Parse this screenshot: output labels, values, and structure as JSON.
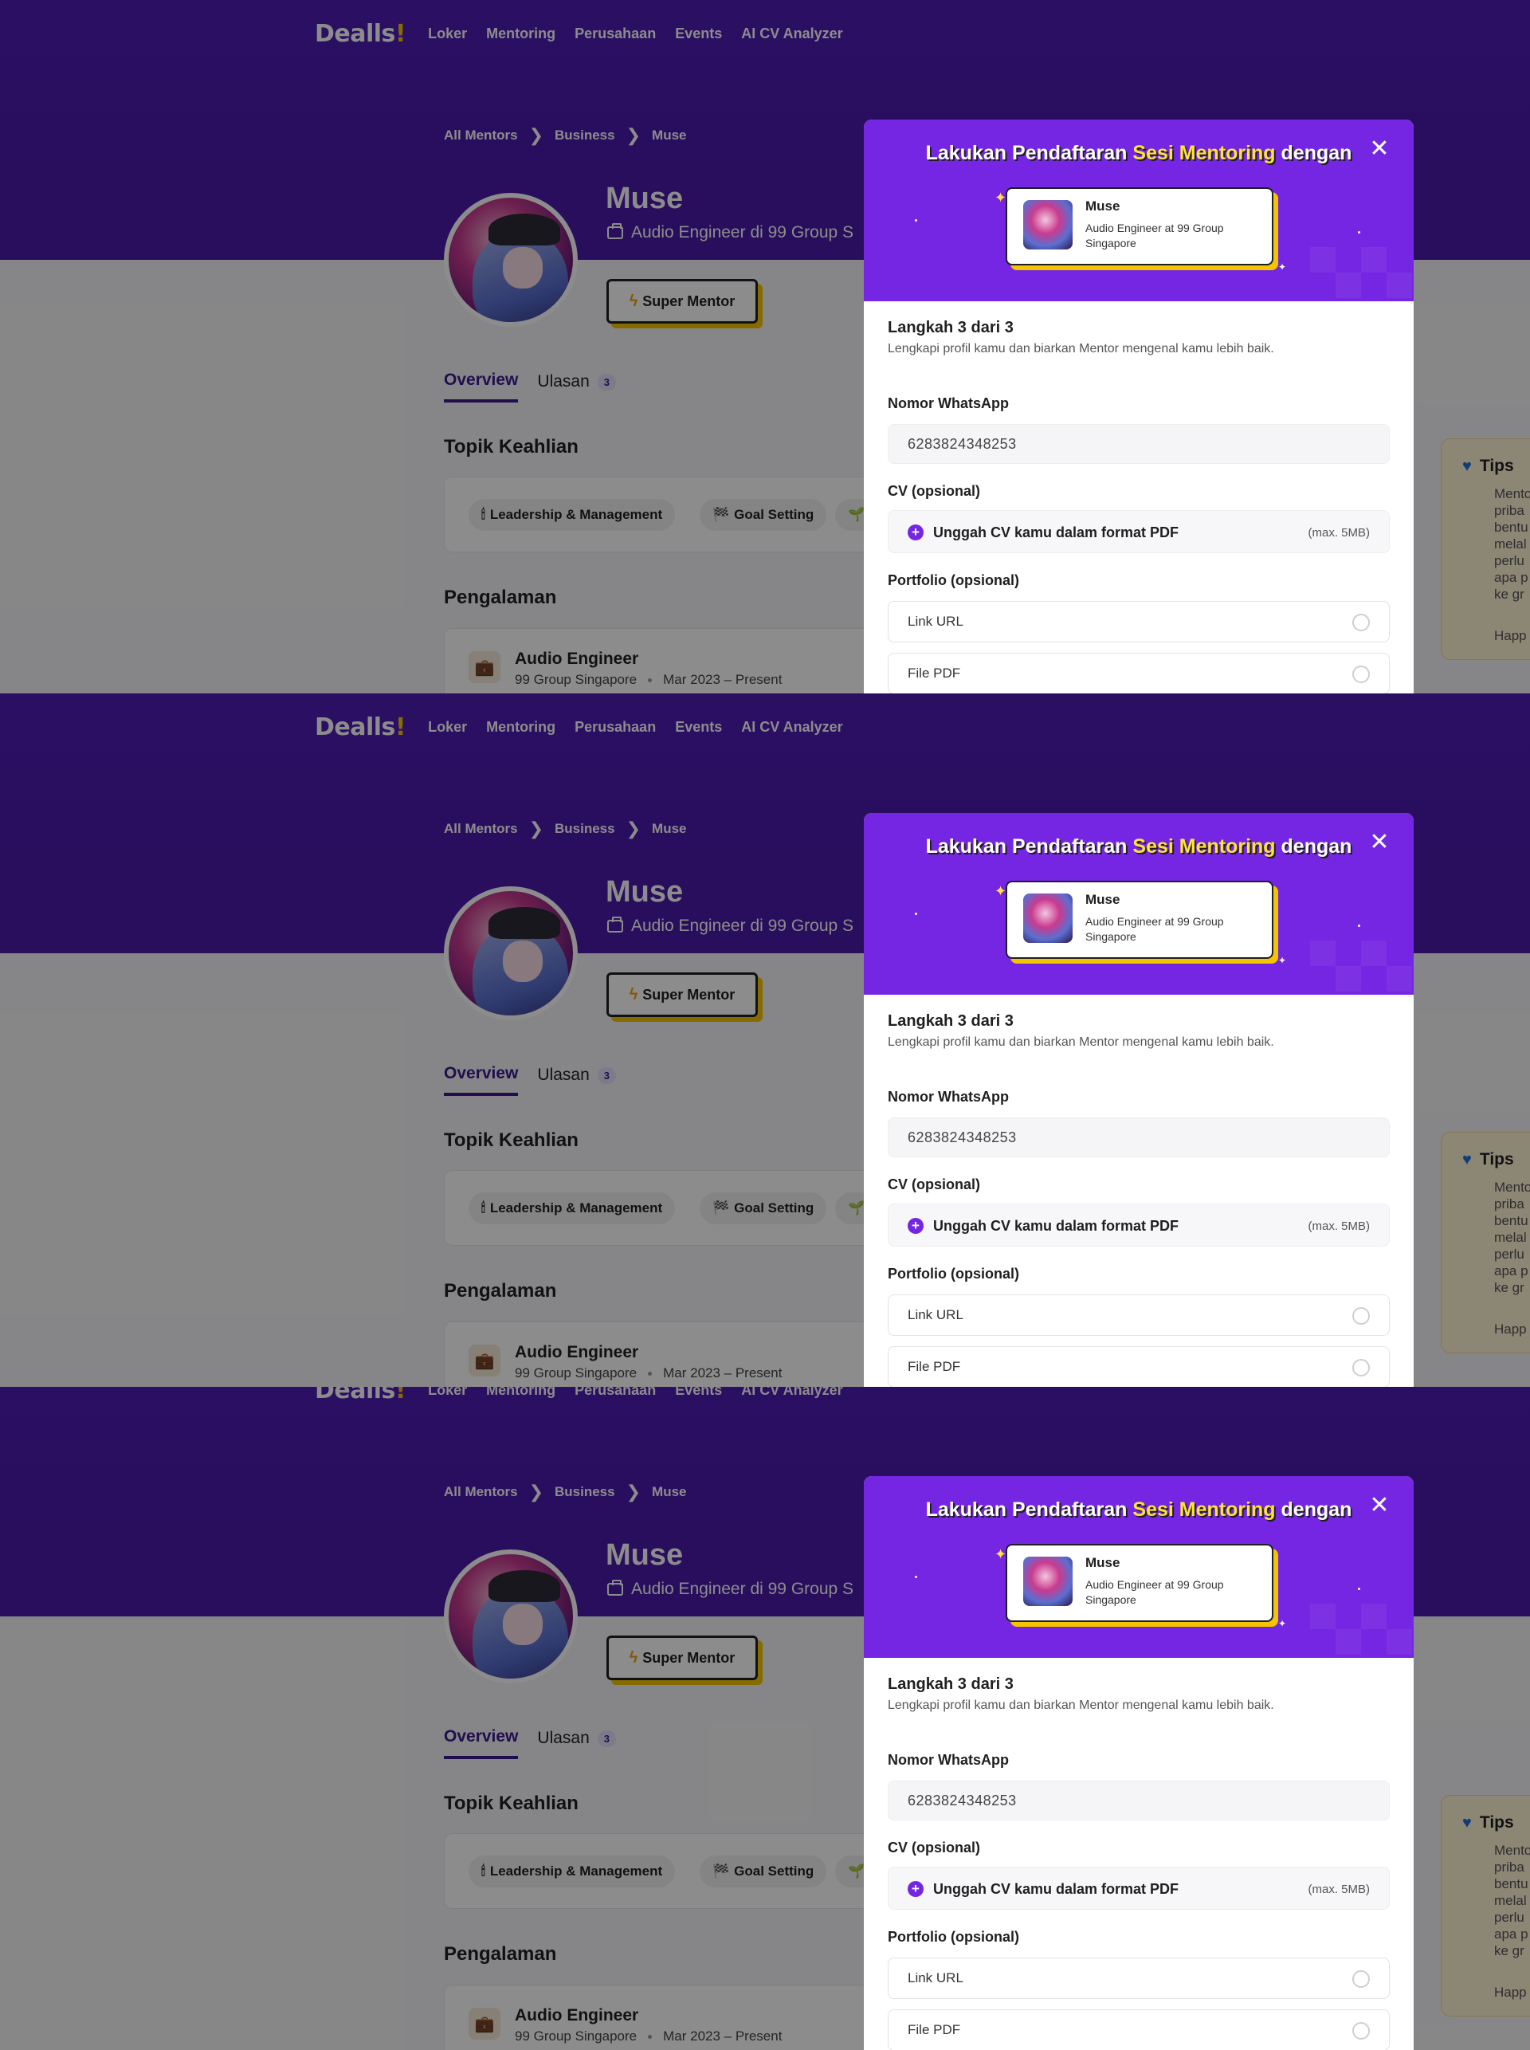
{
  "nav": {
    "logo": "Dealls",
    "logo_mark": "!",
    "links": [
      "Loker",
      "Mentoring",
      "Perusahaan",
      "Events",
      "AI CV Analyzer"
    ]
  },
  "breadcrumb": [
    "All Mentors",
    "Business",
    "Muse"
  ],
  "breadcrumb_sep": "❯",
  "mentor": {
    "name": "Muse",
    "role": "Audio Engineer di 99 Group S",
    "badge": "Super Mentor"
  },
  "tabs": [
    {
      "label": "Overview",
      "active": true
    },
    {
      "label": "Ulasan",
      "count": "3"
    }
  ],
  "sections": {
    "topik": "Topik Keahlian",
    "pengalaman": "Pengalaman"
  },
  "skills": [
    {
      "icon": "🕯",
      "label": "Leadership & Management"
    },
    {
      "icon": "🏁",
      "label": "Goal Setting"
    },
    {
      "icon": "🌱",
      "label": ""
    }
  ],
  "experience": {
    "title": "Audio Engineer",
    "company": "99 Group Singapore",
    "period": "Mar 2023 – Present"
  },
  "tips": {
    "title": "Tips",
    "body": "Mento\npriba\nbentu\nmelal\nperlu\napa p\nke gr",
    "footer": "Happ"
  },
  "modal": {
    "title_pre": "Lakukan Pendaftaran ",
    "title_highlight": "Sesi Mentoring",
    "title_post": " dengan",
    "close": "✕",
    "card": {
      "name": "Muse",
      "role": "Audio Engineer at 99 Group Singapore"
    },
    "step": "Langkah 3 dari 3",
    "step_sub": "Lengkapi profil kamu dan biarkan Mentor mengenal kamu lebih baik.",
    "whatsapp_label": "Nomor WhatsApp",
    "whatsapp_value": "6283824348253",
    "cv_label": "CV (opsional)",
    "cv_upload": "Unggah CV kamu dalam format PDF",
    "cv_max": "(max. 5MB)",
    "portfolio_label": "Portfolio (opsional)",
    "portfolio_options": [
      "Link URL",
      "File PDF"
    ]
  },
  "colors": {
    "brand_purple": "#4e1cb4",
    "modal_purple": "#7426e2",
    "highlight_yellow": "#ffe23d",
    "accent_yellow": "#f5c400"
  }
}
